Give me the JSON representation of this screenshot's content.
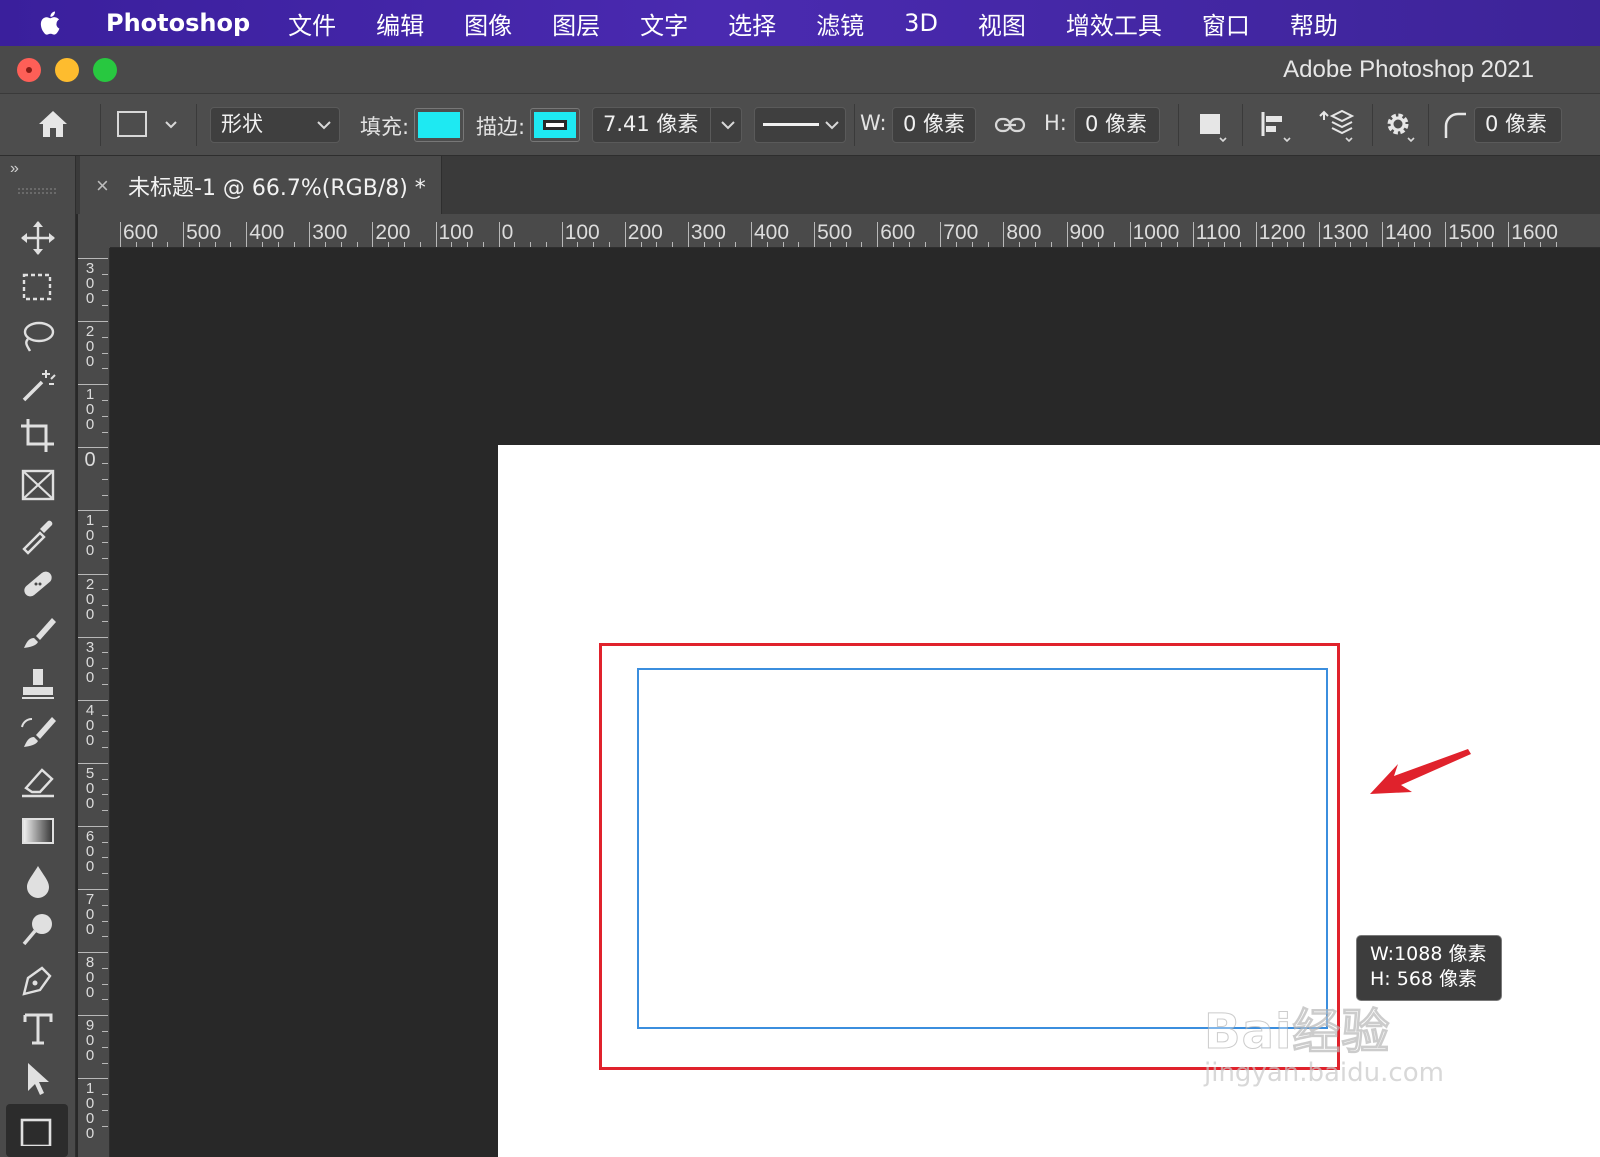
{
  "menubar": {
    "app_name": "Photoshop",
    "items": [
      "文件",
      "编辑",
      "图像",
      "图层",
      "文字",
      "选择",
      "滤镜",
      "3D",
      "视图",
      "增效工具",
      "窗口",
      "帮助"
    ]
  },
  "window": {
    "title": "Adobe Photoshop 2021"
  },
  "options_bar": {
    "mode": "形状",
    "fill_label": "填充:",
    "fill_color": "#1ee9f2",
    "stroke_label": "描边:",
    "stroke_color": "#1ee9f2",
    "stroke_width": "7.41 像素",
    "width_label": "W:",
    "width_value": "0 像素",
    "height_label": "H:",
    "height_value": "0 像素",
    "radius_value": "0 像素"
  },
  "document_tab": {
    "close": "×",
    "title": "未标题-1 @ 66.7%(RGB/8) *"
  },
  "ruler_h": [
    "600",
    "500",
    "400",
    "300",
    "200",
    "100",
    "0",
    "100",
    "200",
    "300",
    "400",
    "500",
    "600",
    "700",
    "800",
    "900",
    "1000",
    "1100",
    "1200",
    "1300",
    "1400",
    "1500",
    "1600"
  ],
  "ruler_v": [
    "300",
    "200",
    "100",
    "0",
    "100",
    "200",
    "300",
    "400",
    "500",
    "600",
    "700",
    "800",
    "900",
    "1000"
  ],
  "tooltip": {
    "width_line": "W:1088 像素",
    "height_line": "H:  568 像素"
  },
  "watermark": {
    "brand": "Bai经验",
    "url": "jingyan.baidu.com"
  },
  "colors": {
    "highlight_box": "#e0222c",
    "shape_path": "#3b8ede",
    "arrow": "#e0222c"
  }
}
